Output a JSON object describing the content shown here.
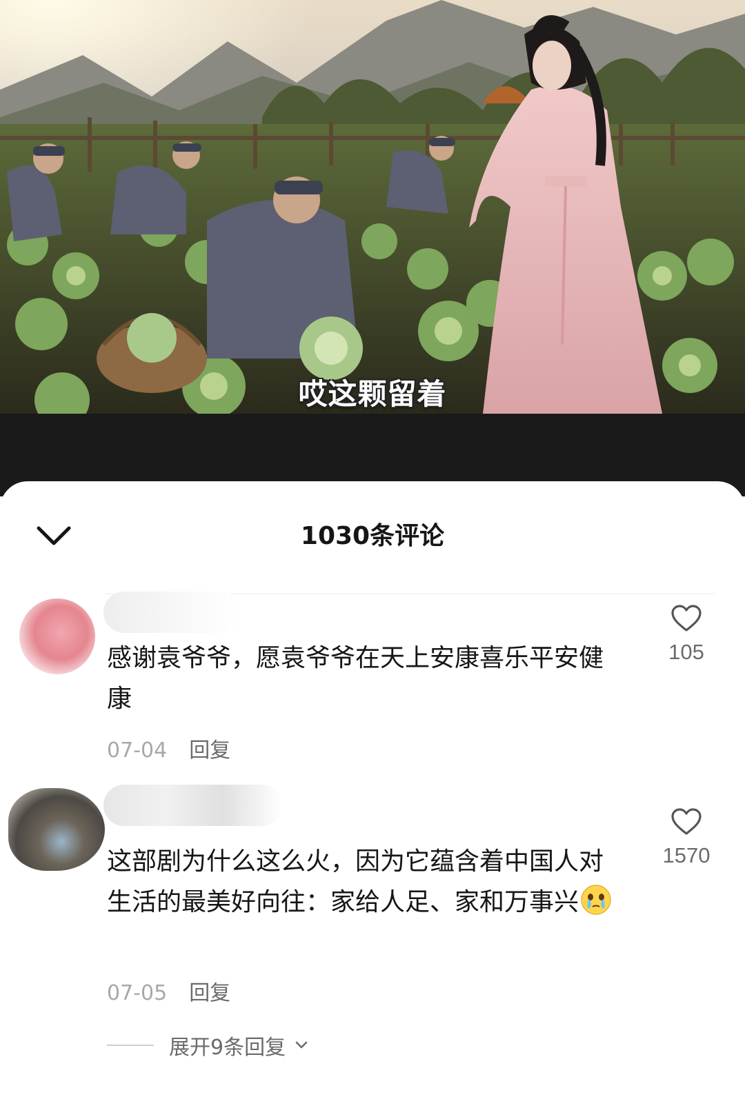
{
  "video": {
    "subtitle": "哎这颗留着"
  },
  "comments_panel": {
    "title": "1030条评论",
    "collapse_icon": "chevron-down-icon"
  },
  "comments": [
    {
      "text": "感谢袁爷爷，愿袁爷爷在天上安康喜乐平安健康",
      "date": "07-04",
      "reply_label": "回复",
      "likes": "105"
    },
    {
      "text": "这部剧为什么这么火，因为它蕴含着中国人对生活的最美好向往：家给人足、家和万事兴",
      "emoji": "crying-face-emoji",
      "date": "07-05",
      "reply_label": "回复",
      "likes": "1570",
      "expand_label": "展开9条回复"
    }
  ],
  "colors": {
    "sheet_bg": "#ffffff",
    "dark_band": "#1a1a1a",
    "text_primary": "#161616",
    "text_secondary": "#a8a8a8"
  }
}
